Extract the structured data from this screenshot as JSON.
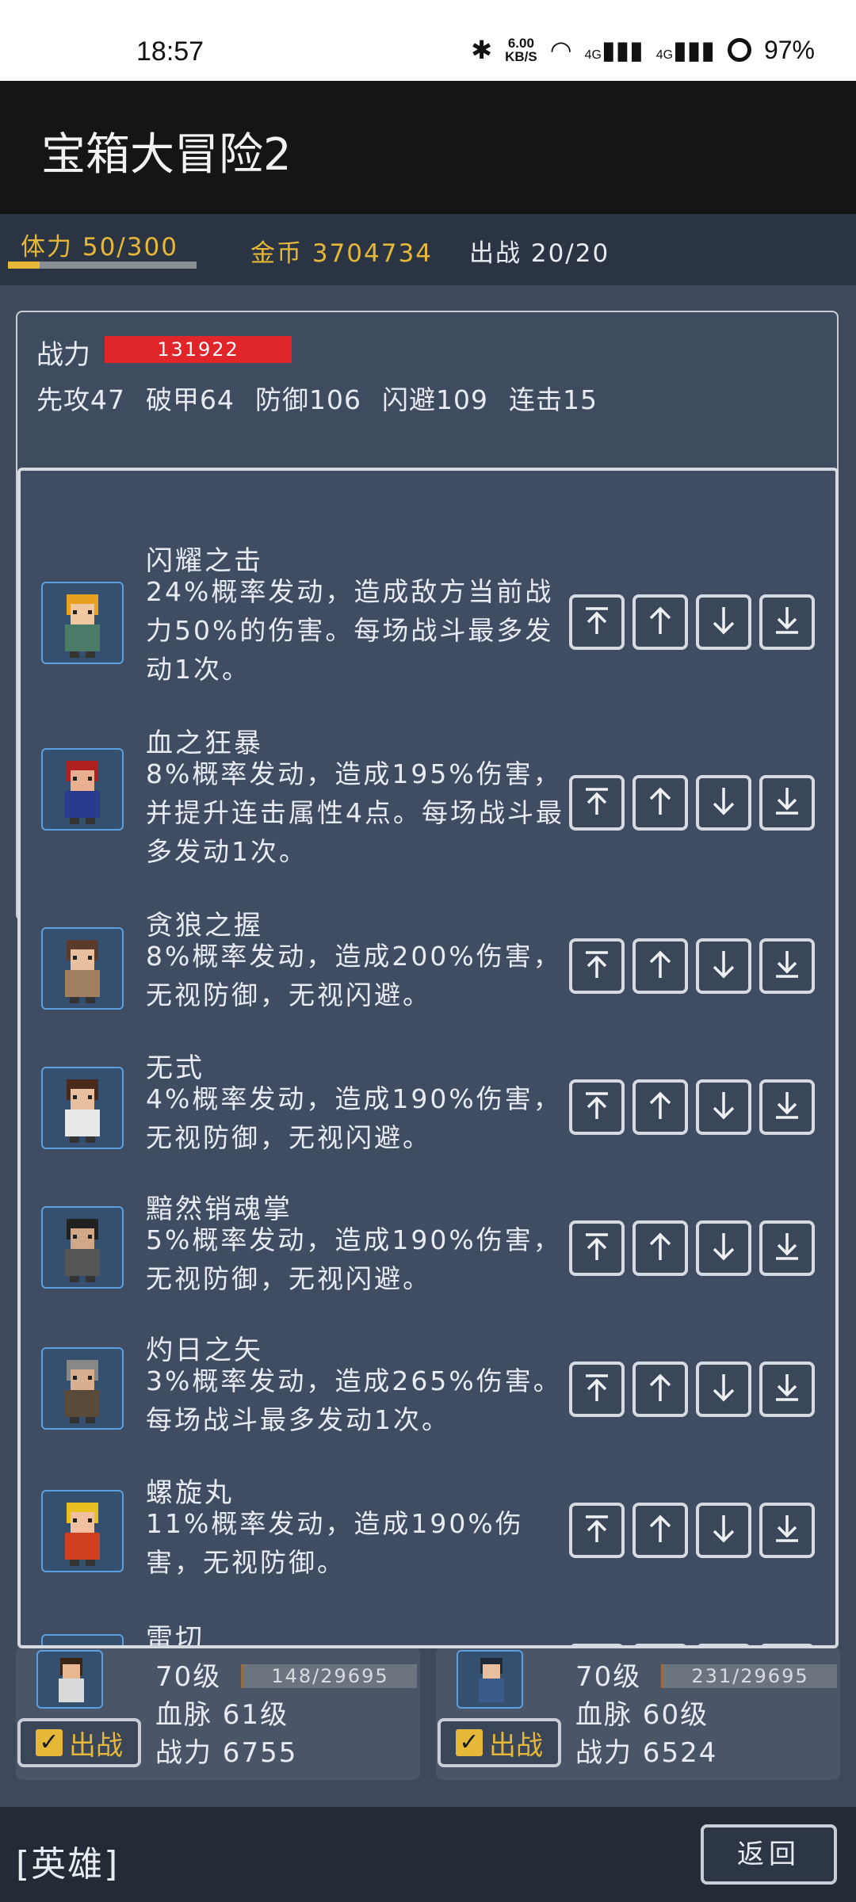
{
  "status_bar": {
    "time": "18:57",
    "net_speed_top": "6.00",
    "net_speed_bottom": "KB/S",
    "signal1": "4G",
    "signal2": "4G",
    "battery": "97%"
  },
  "app": {
    "title": "宝箱大冒险2"
  },
  "resources": {
    "stamina_label": "体力 50/300",
    "stamina_fraction": 0.167,
    "gold_label": "金币 3704734",
    "deploy_label": "出战 20/20"
  },
  "summary": {
    "power_label": "战力",
    "power_value": "131922",
    "stats": [
      "先攻47",
      "破甲64",
      "防御106",
      "闪避109",
      "连击15"
    ]
  },
  "skills": [
    {
      "name": "闪耀之击",
      "desc": "24%概率发动，造成敌方当前战力50%的伤害。每场战斗最多发动1次。"
    },
    {
      "name": "血之狂暴",
      "desc": "8%概率发动，造成195%伤害，并提升连击属性4点。每场战斗最多发动1次。"
    },
    {
      "name": "贪狼之握",
      "desc": "8%概率发动，造成200%伤害，无视防御，无视闪避。"
    },
    {
      "name": "无式",
      "desc": "4%概率发动，造成190%伤害，无视防御，无视闪避。"
    },
    {
      "name": "黯然销魂掌",
      "desc": "5%概率发动，造成190%伤害，无视防御，无视闪避。"
    },
    {
      "name": "灼日之矢",
      "desc": "3%概率发动，造成265%伤害。每场战斗最多发动1次。"
    },
    {
      "name": "螺旋丸",
      "desc": "11%概率发动，造成190%伤害，无视防御。"
    },
    {
      "name": "雷切",
      "desc": ""
    }
  ],
  "heroes": [
    {
      "level": "70级",
      "exp": "148/29695",
      "blood": "血脉  61级",
      "power": "战力  6755",
      "deploy": "出战"
    },
    {
      "level": "70级",
      "exp": "231/29695",
      "blood": "血脉  60级",
      "power": "战力  6524",
      "deploy": "出战"
    }
  ],
  "bottom": {
    "hero_tab": "[英雄]",
    "back": "返回"
  },
  "colors": {
    "accent_gold": "#e6b839",
    "power_red": "#e0262b",
    "panel": "#3f4c61"
  }
}
